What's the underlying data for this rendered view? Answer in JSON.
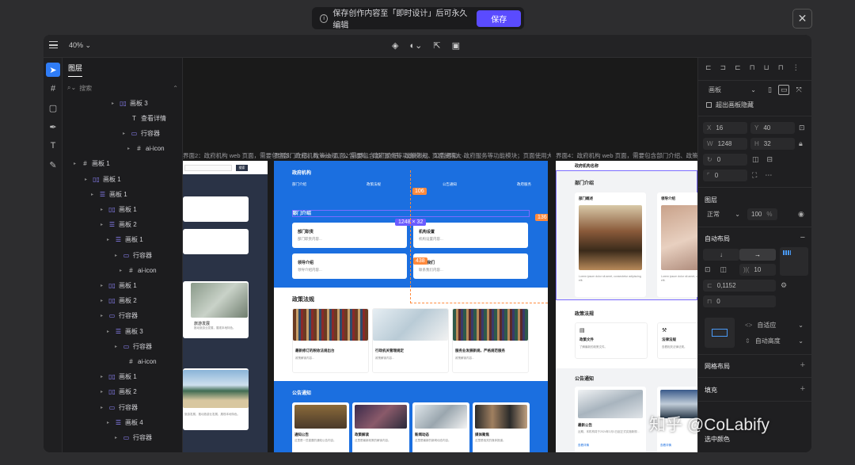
{
  "topbar": {
    "notice": "保存创作内容至「即时设计」后可永久编辑",
    "save_label": "保存"
  },
  "header": {
    "zoom": "40%"
  },
  "layers": {
    "tab": "图层",
    "search_placeholder": "搜索",
    "items": [
      {
        "label": "画板 3",
        "type": "board"
      },
      {
        "label": "查看详情",
        "type": "text"
      },
      {
        "label": "行容器",
        "type": "row"
      },
      {
        "label": "ai-icon",
        "type": "frame"
      },
      {
        "label": "画板 1",
        "type": "frame"
      },
      {
        "label": "画板 1",
        "type": "board"
      },
      {
        "label": "画板 1",
        "type": "list"
      },
      {
        "label": "画板 1",
        "type": "board"
      },
      {
        "label": "画板 2",
        "type": "list"
      },
      {
        "label": "画板 1",
        "type": "list"
      },
      {
        "label": "行容器",
        "type": "row"
      },
      {
        "label": "ai-icon",
        "type": "frame"
      },
      {
        "label": "画板 1",
        "type": "board"
      },
      {
        "label": "画板 2",
        "type": "board"
      },
      {
        "label": "行容器",
        "type": "row"
      },
      {
        "label": "画板 3",
        "type": "list"
      },
      {
        "label": "行容器",
        "type": "row"
      },
      {
        "label": "ai-icon",
        "type": "frame"
      },
      {
        "label": "画板 1",
        "type": "board"
      },
      {
        "label": "画板 2",
        "type": "board"
      },
      {
        "label": "行容器",
        "type": "row"
      },
      {
        "label": "画板 4",
        "type": "list"
      },
      {
        "label": "行容器",
        "type": "row"
      }
    ]
  },
  "canvas": {
    "board_labels": [
      "界面2：政府机构 web 页面，需要包含部门介绍、政策法规、公告通知、政府服务等功能模块；页面使用大···",
      "界面3：政府机构 web 页面，需要包含部门介绍、政策法规、公告通知、政府服务等功能模块；页面使用大···",
      "界面4：政府机构 web 页面，需要包含部门介绍、政策法规、公告通知、政府服务等功能模块；页面使用大···"
    ],
    "b1": {
      "search_btn": "搜索",
      "card_title": "旅游发展",
      "card_sub": "推动旅游业发展，展现本地特色。",
      "card_sub2": "旅游发展，推动旅游业发展，展现本地特色。"
    },
    "b2": {
      "brand": "政府机构",
      "nav": [
        "部门介绍",
        "政策法规",
        "公告通知",
        "政府服务"
      ],
      "dept_title": "部门介绍",
      "dept_cards": [
        {
          "title": "部门职责",
          "sub": "部门职责内容..."
        },
        {
          "title": "机构设置",
          "sub": "机构设置内容..."
        },
        {
          "title": "领导介绍",
          "sub": "领导介绍内容..."
        },
        {
          "title": "联系我们",
          "sub": "联系我们内容..."
        }
      ],
      "policy_title": "政策法规",
      "policy_cards": [
        {
          "title": "最新修订的税收法规出台",
          "sub": "政策解读内容..."
        },
        {
          "title": "行政机关管理规定",
          "sub": "政策解读内容..."
        },
        {
          "title": "服务业发展新规，严格规范服务",
          "sub": "政策解读内容..."
        }
      ],
      "notice_title": "公告通知",
      "notice_cards": [
        {
          "title": "通知公告",
          "sub": "这里是一些重要的通知公告内容。"
        },
        {
          "title": "政策解读",
          "sub": "这里是最新政策的解读内容。"
        },
        {
          "title": "新闻动态",
          "sub": "这里是最新的新闻动态内容。"
        },
        {
          "title": "媒体聚焦",
          "sub": "这里是相关的媒体报道。"
        }
      ],
      "selection_size": "1248 × 32",
      "measure_left": "106",
      "measure_right": "136",
      "measure_bottom": "438"
    },
    "b3": {
      "brand": "政府机构名称",
      "dept_title": "部门介绍",
      "dept_cards": [
        {
          "title": "部门概述",
          "sub": "Lorem ipsum dolor sit amet, consectetur adipiscing elit."
        },
        {
          "title": "领导介绍",
          "sub": "Lorem ipsum dolor sit amet, consectetur adipiscing elit."
        }
      ],
      "policy_title": "政策法规",
      "policy_cards": [
        {
          "title": "政策文件",
          "sub": "了解最新的政策文件。"
        },
        {
          "title": "法律法规",
          "sub": "查看相关法律法规。"
        }
      ],
      "notice_title": "公告通知",
      "notice_cards": [
        {
          "title": "最新公告",
          "sub": "近期，本机构将于2024年2月1日起正式实施新规..."
        },
        {
          "title": "",
          "sub": ""
        }
      ],
      "link": "查看详情"
    }
  },
  "props": {
    "frame_type": "画板",
    "clip_label": "超出画板隐藏",
    "x": "16",
    "y": "40",
    "w": "1248",
    "h": "32",
    "rotation": "0",
    "radius": "0",
    "layer_title": "图层",
    "blend": "正常",
    "opacity": "100",
    "opacity_unit": "%",
    "autolayout_title": "自动布局",
    "gap": "10",
    "padding_h": "0,1152",
    "padding_v": "0",
    "width_mode": "自适应",
    "height_mode": "自动高度",
    "grid_title": "网格布局",
    "fill_title": "填充",
    "selection_color_title": "选中颜色"
  },
  "watermark": "知乎 @CoLabify",
  "colors": {
    "accent": "#5a4bff",
    "tool_active": "#2f7cf6",
    "board_blue": "#1b6fe0",
    "measure": "#ff8a3d"
  }
}
